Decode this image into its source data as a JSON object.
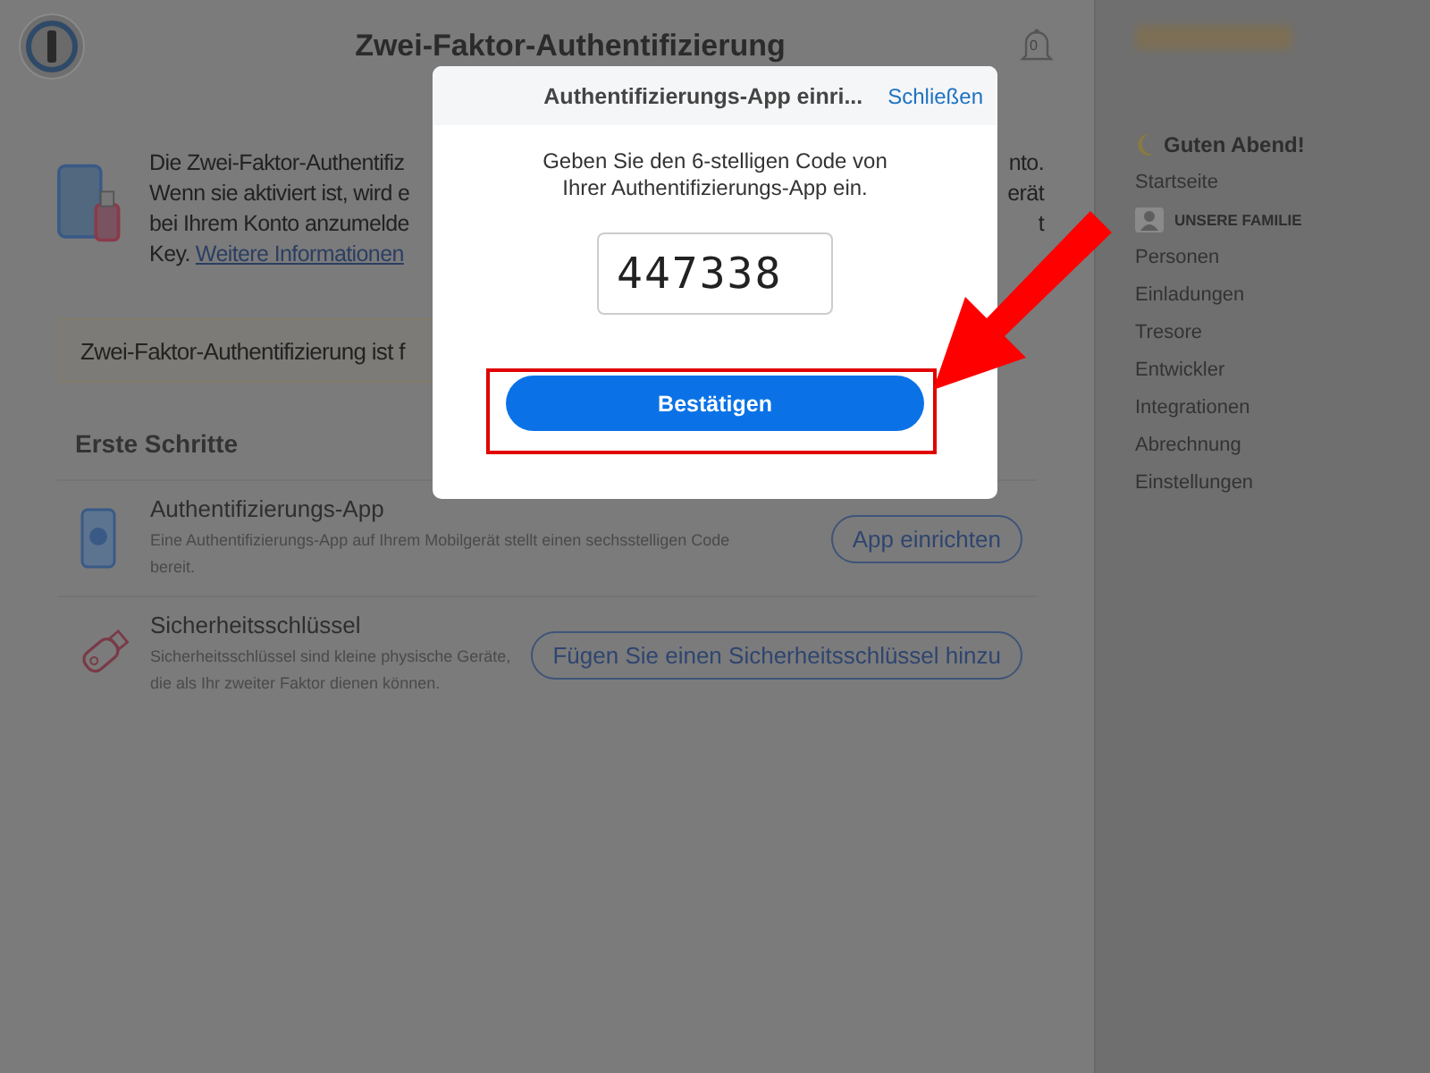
{
  "header": {
    "title": "Zwei-Faktor-Authentifizierung",
    "notification_count": "0"
  },
  "intro": {
    "lines": [
      {
        "left": "Die Zwei-Faktor-Authentifiz",
        "right": "nto."
      },
      {
        "left": "Wenn sie aktiviert ist, wird e",
        "right": "erät"
      },
      {
        "left": "bei Ihrem Konto anzumelde",
        "right": "t"
      },
      {
        "left": "Key.",
        "link": "Weitere Informationen"
      }
    ]
  },
  "banner": {
    "text": "Zwei-Faktor-Authentifizierung ist f"
  },
  "steps": {
    "heading": "Erste Schritte",
    "items": [
      {
        "kind": "phone",
        "title": "Authentifizierungs-App",
        "description": "Eine Authentifizierungs-App auf Ihrem Mobilgerät stellt einen sechsstelligen Code bereit.",
        "button": "App einrichten"
      },
      {
        "kind": "key",
        "title": "Sicherheitsschlüssel",
        "description": "Sicherheitsschlüssel sind kleine physische Geräte, die als Ihr zweiter Faktor dienen können.",
        "button": "Fügen Sie einen Sicherheitsschlüssel hinzu"
      }
    ]
  },
  "sidebar": {
    "greeting": "Guten Abend!",
    "items": [
      {
        "kind": "link",
        "label": "Startseite"
      },
      {
        "kind": "section",
        "label": "UNSERE FAMILIE"
      },
      {
        "kind": "link",
        "label": "Personen"
      },
      {
        "kind": "link",
        "label": "Einladungen"
      },
      {
        "kind": "link",
        "label": "Tresore"
      },
      {
        "kind": "link",
        "label": "Entwickler"
      },
      {
        "kind": "link",
        "label": "Integrationen"
      },
      {
        "kind": "link",
        "label": "Abrechnung"
      },
      {
        "kind": "link",
        "label": "Einstellungen"
      }
    ]
  },
  "modal": {
    "title": "Authentifizierungs-App einri...",
    "close": "Schließen",
    "prompt": "Geben Sie den 6-stelligen Code von Ihrer Authentifizierungs-App ein.",
    "code": "447338",
    "confirm": "Bestätigen"
  }
}
